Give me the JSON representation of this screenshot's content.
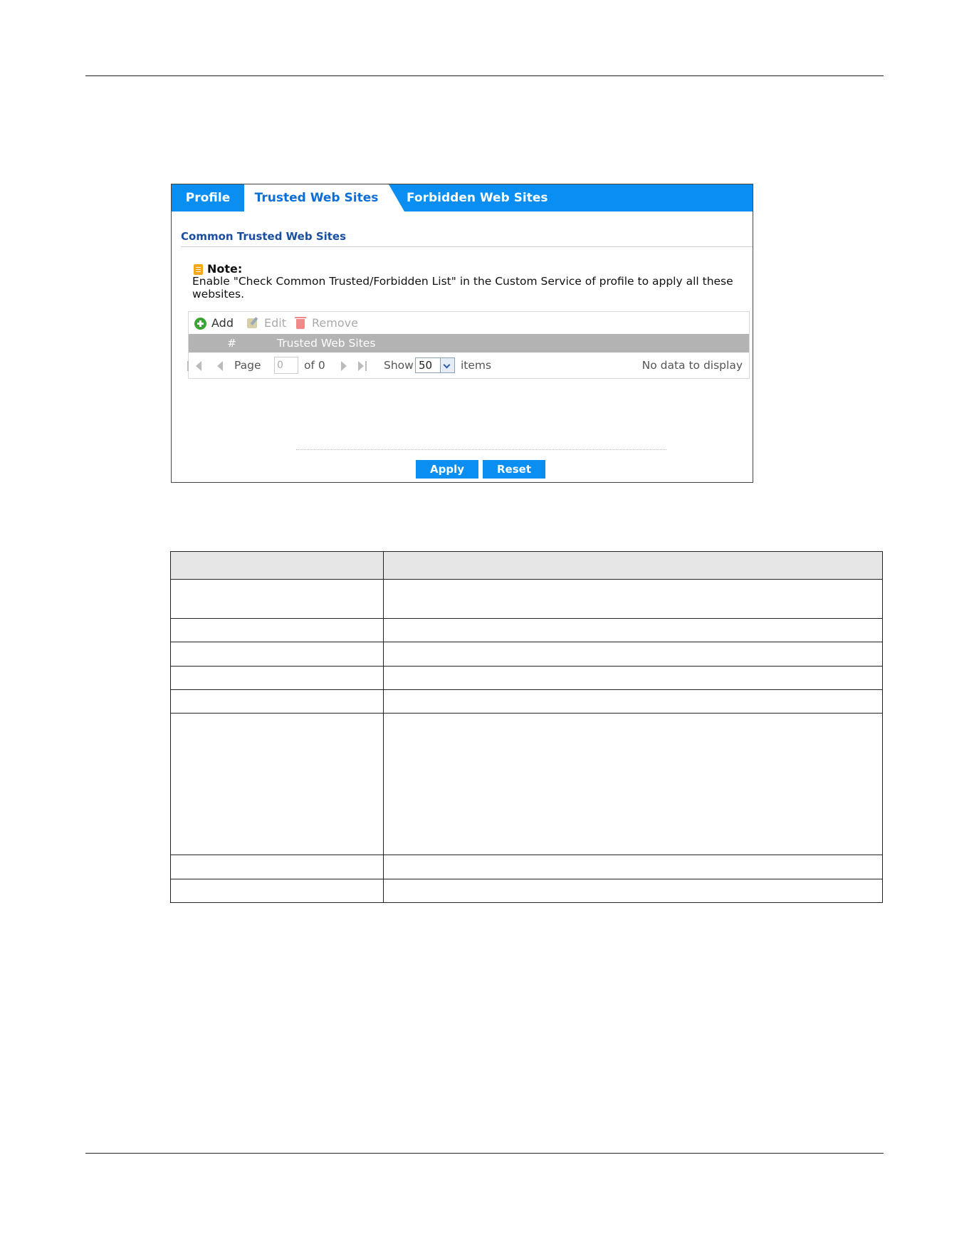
{
  "tabs": [
    {
      "label": "Profile"
    },
    {
      "label": "Trusted Web Sites"
    },
    {
      "label": "Forbidden Web Sites"
    }
  ],
  "section_title": "Common Trusted Web Sites",
  "note": {
    "label": "Note:",
    "text": "Enable \"Check Common Trusted/Forbidden List\" in the Custom Service of profile to apply all these websites."
  },
  "toolbar": {
    "add": "Add",
    "edit": "Edit",
    "remove": "Remove"
  },
  "grid": {
    "columns": [
      "#",
      "Trusted Web Sites"
    ]
  },
  "pager": {
    "page_label": "Page",
    "page_value": "0",
    "of_label": "of 0",
    "show_label": "Show",
    "show_value": "50",
    "items_label": "items",
    "status": "No data to display"
  },
  "buttons": {
    "apply": "Apply",
    "reset": "Reset"
  },
  "colors": {
    "accent": "#0a8ef2",
    "header_grey": "#b3b3b3",
    "section_title": "#1a4fa0"
  }
}
